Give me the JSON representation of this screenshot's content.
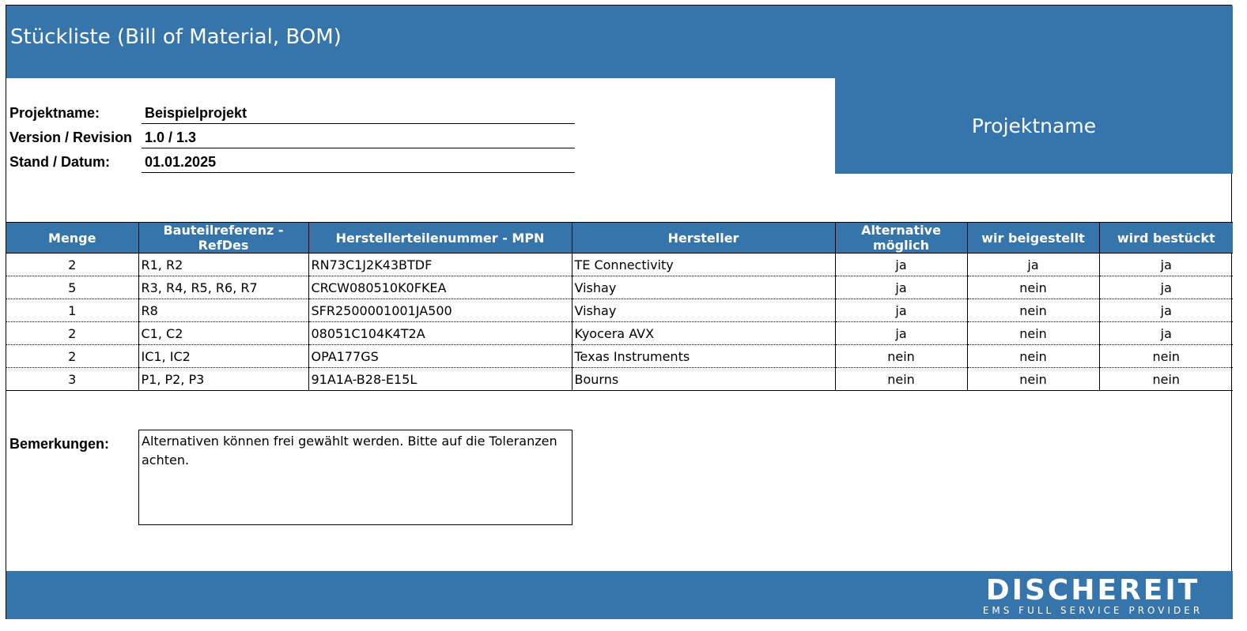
{
  "header": {
    "title": "Stückliste (Bill of Material, BOM)",
    "project_box": "Projektname"
  },
  "meta": {
    "project_label": "Projektname:",
    "project_value": "Beispielprojekt",
    "version_label": "Version / Revision",
    "version_value": "1.0 / 1.3",
    "date_label": "Stand / Datum:",
    "date_value": "01.01.2025"
  },
  "table": {
    "columns": [
      "Menge",
      "Bauteilreferenz - RefDes",
      "Herstellerteilenummer - MPN",
      "Hersteller",
      "Alternative möglich",
      "wir beigestellt",
      "wird bestückt"
    ],
    "rows": [
      [
        "2",
        "R1, R2",
        "RN73C1J2K43BTDF",
        "TE Connectivity",
        "ja",
        "ja",
        "ja"
      ],
      [
        "5",
        "R3, R4, R5, R6, R7",
        "CRCW080510K0FKEA",
        "Vishay",
        "ja",
        "nein",
        "ja"
      ],
      [
        "1",
        "R8",
        "SFR2500001001JA500",
        "Vishay",
        "ja",
        "nein",
        "ja"
      ],
      [
        "2",
        "C1, C2",
        "08051C104K4T2A",
        "Kyocera AVX",
        "ja",
        "nein",
        "ja"
      ],
      [
        "2",
        "IC1, IC2",
        "OPA177GS",
        "Texas Instruments",
        "nein",
        "nein",
        "nein"
      ],
      [
        "3",
        "P1, P2, P3",
        "91A1A-B28-E15L",
        "Bourns",
        "nein",
        "nein",
        "nein"
      ]
    ]
  },
  "remarks": {
    "label": "Bemerkungen:",
    "text": "Alternativen können frei gewählt werden. Bitte auf die Toleranzen achten."
  },
  "footer": {
    "logo_main": "DISCHEREIT",
    "logo_sub": "EMS FULL SERVICE PROVIDER"
  },
  "colors": {
    "brand_blue": "#3674ac"
  }
}
